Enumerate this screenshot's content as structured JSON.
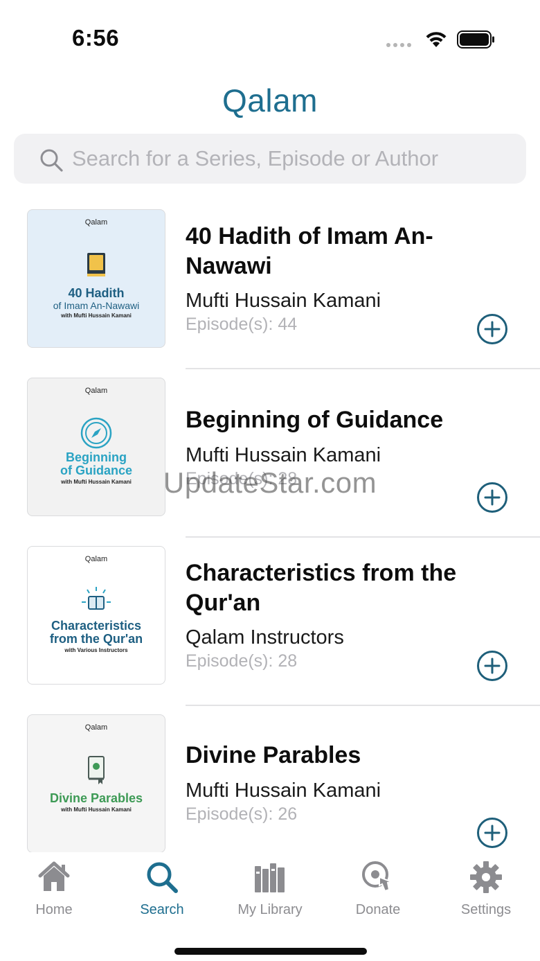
{
  "status": {
    "time": "6:56"
  },
  "header": {
    "logo": "Qalam"
  },
  "search": {
    "placeholder": "Search for a Series, Episode or Author"
  },
  "series": [
    {
      "title": "40 Hadith of Imam An-Nawawi",
      "author": "Mufti Hussain Kamani",
      "episodes": "Episode(s): 44",
      "thumb": {
        "brand": "Qalam",
        "line1": "40 Hadith",
        "line2": "of Imam An-Nawawi",
        "line3": "with Mufti Hussain Kamani",
        "bg": "#e3eef8",
        "color": "#1e5f82"
      }
    },
    {
      "title": "Beginning of Guidance",
      "author": "Mufti Hussain Kamani",
      "episodes": "Episode(s): 28",
      "thumb": {
        "brand": "Qalam",
        "line1": "Beginning",
        "line2": "of Guidance",
        "line3": "with Mufti Hussain Kamani",
        "bg": "#f2f2f2",
        "color": "#2aa3c3"
      }
    },
    {
      "title": "Characteristics from the Qur'an",
      "author": "Qalam Instructors",
      "episodes": "Episode(s): 28",
      "thumb": {
        "brand": "Qalam",
        "line1": "Characteristics",
        "line2": "from the Qur'an",
        "line3": "with Various Instructors",
        "bg": "#ffffff",
        "color": "#1e5f82"
      }
    },
    {
      "title": "Divine Parables",
      "author": "Mufti Hussain Kamani",
      "episodes": "Episode(s): 26",
      "thumb": {
        "brand": "Qalam",
        "line1": "Divine Parables",
        "line2": "",
        "line3": "with Mufti Hussain Kamani",
        "bg": "#f5f5f5",
        "color": "#3d9a55"
      }
    }
  ],
  "watermark": "UpdateStar.com",
  "tabs": [
    {
      "label": "Home",
      "icon": "home-icon"
    },
    {
      "label": "Search",
      "icon": "search-icon"
    },
    {
      "label": "My Library",
      "icon": "library-icon"
    },
    {
      "label": "Donate",
      "icon": "donate-icon"
    },
    {
      "label": "Settings",
      "icon": "gear-icon"
    }
  ],
  "colors": {
    "accent": "#1e6e8f",
    "inactive_tab": "#8c8c90",
    "add_button": "#1e5f7a"
  }
}
